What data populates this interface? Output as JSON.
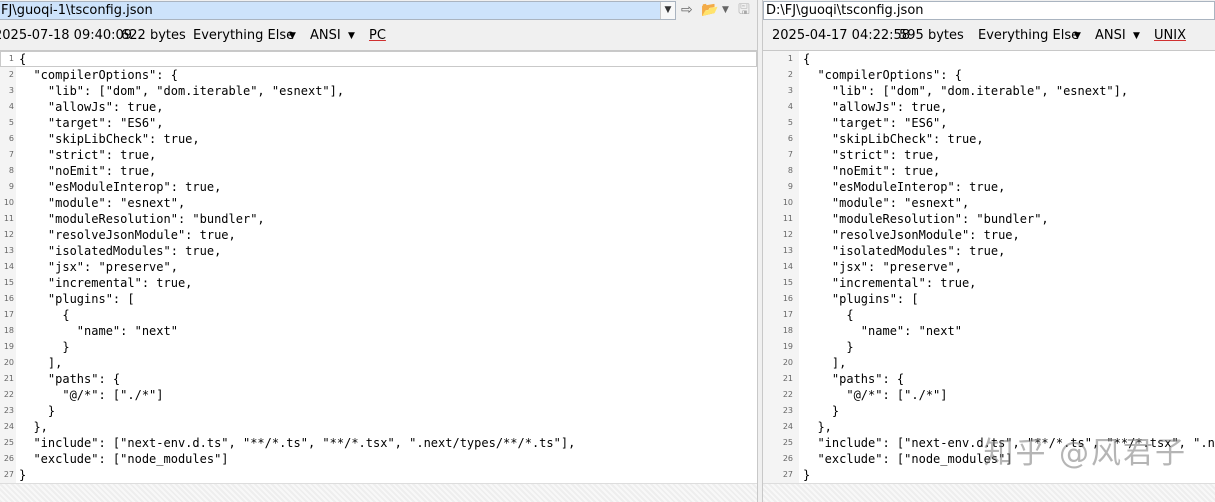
{
  "left": {
    "path": "FJ\\guoqi-1\\tsconfig.json",
    "timestamp": "2025-07-18 09:40:09",
    "size": "622 bytes",
    "filter": "Everything Else",
    "encoding": "ANSI",
    "eol": "PC"
  },
  "right": {
    "path": "D:\\FJ\\guoqi\\tsconfig.json",
    "timestamp": "2025-04-17 04:22:58",
    "size": "595 bytes",
    "filter": "Everything Else",
    "encoding": "ANSI",
    "eol": "UNIX"
  },
  "lines": [
    {
      "n": "1",
      "left": "{",
      "right": "{"
    },
    {
      "n": "2",
      "left": "  \"compilerOptions\": {",
      "right": "  \"compilerOptions\": {"
    },
    {
      "n": "3",
      "left": "    \"lib\": [\"dom\", \"dom.iterable\", \"esnext\"],",
      "right": "    \"lib\": [\"dom\", \"dom.iterable\", \"esnext\"],"
    },
    {
      "n": "4",
      "left": "    \"allowJs\": true,",
      "right": "    \"allowJs\": true,"
    },
    {
      "n": "5",
      "left": "    \"target\": \"ES6\",",
      "right": "    \"target\": \"ES6\","
    },
    {
      "n": "6",
      "left": "    \"skipLibCheck\": true,",
      "right": "    \"skipLibCheck\": true,"
    },
    {
      "n": "7",
      "left": "    \"strict\": true,",
      "right": "    \"strict\": true,"
    },
    {
      "n": "8",
      "left": "    \"noEmit\": true,",
      "right": "    \"noEmit\": true,"
    },
    {
      "n": "9",
      "left": "    \"esModuleInterop\": true,",
      "right": "    \"esModuleInterop\": true,"
    },
    {
      "n": "10",
      "left": "    \"module\": \"esnext\",",
      "right": "    \"module\": \"esnext\","
    },
    {
      "n": "11",
      "left": "    \"moduleResolution\": \"bundler\",",
      "right": "    \"moduleResolution\": \"bundler\","
    },
    {
      "n": "12",
      "left": "    \"resolveJsonModule\": true,",
      "right": "    \"resolveJsonModule\": true,"
    },
    {
      "n": "13",
      "left": "    \"isolatedModules\": true,",
      "right": "    \"isolatedModules\": true,"
    },
    {
      "n": "14",
      "left": "    \"jsx\": \"preserve\",",
      "right": "    \"jsx\": \"preserve\","
    },
    {
      "n": "15",
      "left": "    \"incremental\": true,",
      "right": "    \"incremental\": true,"
    },
    {
      "n": "16",
      "left": "    \"plugins\": [",
      "right": "    \"plugins\": ["
    },
    {
      "n": "17",
      "left": "      {",
      "right": "      {"
    },
    {
      "n": "18",
      "left": "        \"name\": \"next\"",
      "right": "        \"name\": \"next\""
    },
    {
      "n": "19",
      "left": "      }",
      "right": "      }"
    },
    {
      "n": "20",
      "left": "    ],",
      "right": "    ],"
    },
    {
      "n": "21",
      "left": "    \"paths\": {",
      "right": "    \"paths\": {"
    },
    {
      "n": "22",
      "left": "      \"@/*\": [\"./*\"]",
      "right": "      \"@/*\": [\"./*\"]"
    },
    {
      "n": "23",
      "left": "    }",
      "right": "    }"
    },
    {
      "n": "24",
      "left": "  },",
      "right": "  },"
    },
    {
      "n": "25",
      "left": "  \"include\": [\"next-env.d.ts\", \"**/*.ts\", \"**/*.tsx\", \".next/types/**/*.ts\"],",
      "right": "  \"include\": [\"next-env.d.ts\", \"**/*.ts\", \"**/*.tsx\", \".next/types/**/*.ts\"],"
    },
    {
      "n": "26",
      "left": "  \"exclude\": [\"node_modules\"]",
      "right": "  \"exclude\": [\"node_modules\"]"
    },
    {
      "n": "27",
      "left": "}",
      "right": "}"
    }
  ],
  "watermark": "知乎 @风君子",
  "icons": {
    "dropdown": "chevron-down-icon",
    "refresh": "refresh-icon",
    "open": "folder-open-icon",
    "save": "save-icon"
  }
}
